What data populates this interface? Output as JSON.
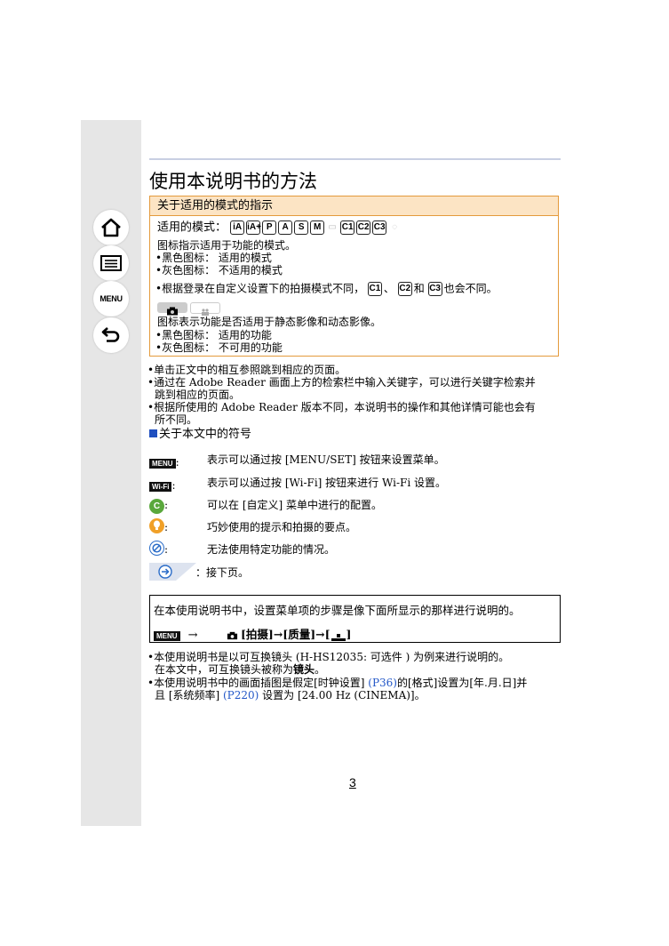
{
  "nav": {
    "menu_label": "MENU"
  },
  "page": {
    "title": "使用本说明书的方法",
    "number": "3"
  },
  "mode_box": {
    "header": "关于适用的模式的指示",
    "modes_label": "适用的模式：",
    "modes": [
      "iA",
      "iA+",
      "P",
      "A",
      "S",
      "M",
      "",
      "C1",
      "C2",
      "C3",
      ""
    ],
    "desc1": "图标指示适用于功能的模式。",
    "black": "•黑色图标：  适用的模式",
    "grey": "•灰色图标：  不适用的模式",
    "custom_pre": "•根据登录在自定义设置下的拍摄模式不同，",
    "c1": "C1",
    "sep1": "、",
    "c2": "C2",
    "sep2": "和",
    "c3": "C3",
    "custom_post": "也会不同。",
    "desc2": "图标表示功能是否适用于静态影像和动态影像。",
    "black2": "•黑色图标：  适用的功能",
    "grey2": "•灰色图标：  不可用的功能"
  },
  "bullets": {
    "b1": "•单击正文中的相互参照跳到相应的页面。",
    "b2a": "•通过在 Adobe Reader 画面上方的检索栏中输入关键字，可以进行关键字检索并",
    "b2b": "跳到相应的页面。",
    "b3a": "•根据所使用的 Adobe Reader 版本不同，本说明书的操作和其他详情可能也会有",
    "b3b": "所不同。"
  },
  "symbols": {
    "heading": "关于本文中的符号",
    "menu_tag": "MENU",
    "wifi_tag": "Wi-Fi",
    "colon": ":",
    "menu_desc": "表示可以通过按 [MENU/SET] 按钮来设置菜单。",
    "wifi_desc": "表示可以通过按 [Wi-Fi] 按钮来进行 Wi-Fi 设置。",
    "custom_desc": "可以在 [自定义] 菜单中进行的配置。",
    "tip_desc": "巧妙使用的提示和拍摄的要点。",
    "no_desc": "无法使用特定功能的情况。",
    "next_desc": "：接下页。"
  },
  "steps_box": {
    "text": "在本使用说明书中，设置菜单项的步骤是像下面所显示的那样进行说明的。",
    "menu_tag": "MENU",
    "arrow": "→",
    "path": "[拍摄]→[质量]→[",
    "path_end": "]"
  },
  "notes": {
    "n1a": "•本使用说明书是以可互换镜头 (H-HS12035: 可选件 ) 为例来进行说明的。",
    "n1b_pre": "在本文中，可互换镜头被称为",
    "n1b_bold": "镜头",
    "n1b_post": "。",
    "n2a_1": "•本使用说明书中的画面插图是假定[时钟设置] ",
    "n2a_link": "(P36)",
    "n2a_2": "的[格式]设置为[年.月.日]并",
    "n2b_1": "且 [系统频率] ",
    "n2b_link": "(P220)",
    "n2b_2": " 设置为 [24.00 Hz (CINEMA)]。"
  },
  "colors": {
    "accent_orange": "#e49a3c",
    "header_fill": "#fce4c4",
    "link_blue": "#2458c8",
    "custom_green": "#5aa83c",
    "tip_orange": "#f0a028",
    "no_blue": "#2a6cc8"
  }
}
